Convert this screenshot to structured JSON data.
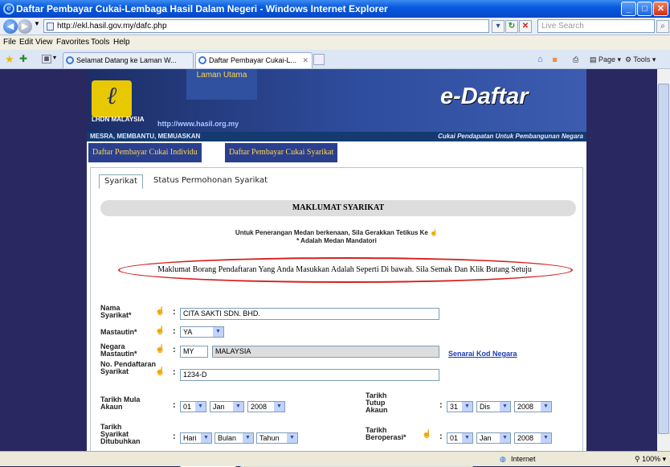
{
  "window": {
    "title": "Daftar Pembayar Cukai-Lembaga Hasil Dalam Negeri - Windows Internet Explorer"
  },
  "address": {
    "url": "http://ekl.hasil.gov.my/dafc.php",
    "search_placeholder": "Live Search"
  },
  "menu": [
    "File",
    "Edit",
    "View",
    "Favorites",
    "Tools",
    "Help"
  ],
  "tabs": [
    "Selamat Datang ke Laman W...",
    "Daftar Pembayar Cukai-L..."
  ],
  "command": {
    "page": "Page",
    "tools": "Tools"
  },
  "site": {
    "laman_utama": "Laman Utama",
    "logo_top": "LHDN",
    "logo_bottom": "MALAYSIA",
    "url_text": "http://www.hasil.org.my",
    "brand": "e-Daftar",
    "slogan_left": "MESRA, MEMBANTU, MEMUASKAN",
    "slogan_right": "Cukai Pendapatan Untuk Pembangunan Negara",
    "nav": [
      "Daftar Pembayar Cukai Individu",
      "Daftar Pembayar Cukai Syarikat"
    ]
  },
  "panel": {
    "tabs": [
      "Syarikat",
      "Status Permohonan Syarikat"
    ],
    "section_title": "MAKLUMAT SYARIKAT",
    "info_line1": "Untuk Penerangan Medan berkenaan,  Sila Gerakkan Tetikus Ke",
    "info_line2": "* Adalah Medan Mandatori",
    "notice": "Maklumat Borang Pendaftaran Yang Anda Masukkan Adalah Seperti Di bawah. Sila Semak Dan Klik Butang Setuju"
  },
  "form": {
    "nama_label": "Nama Syarikat*",
    "nama_value": "CITA SAKTI SDN. BHD.",
    "mastautin_label": "Mastautin*",
    "mastautin_value": "YA",
    "negara_label": "Negara Mastautin*",
    "negara_code": "MY",
    "negara_name": "MALAYSIA",
    "senarai_link": "Senarai Kod Negara",
    "no_label": "No. Pendaftaran Syarikat",
    "no_value": "1234-D",
    "mula_label": "Tarikh Mula Akaun",
    "mula_day": "01",
    "mula_month": "Jan",
    "mula_year": "2008",
    "tutup_label": "Tarikh Tutup Akaun",
    "tutup_day": "31",
    "tutup_month": "Dis",
    "tutup_year": "2008",
    "ditubuhkan_label": "Tarikh Syarikat Ditubuhkan",
    "dit_day": "Hari",
    "dit_month": "Bulan",
    "dit_year": "Tahun",
    "beroperasi_label": "Tarikh Beroperasi*",
    "ber_day": "01",
    "ber_month": "Jan",
    "ber_year": "2008"
  },
  "status": {
    "zone": "Internet",
    "zoom": "100%"
  }
}
